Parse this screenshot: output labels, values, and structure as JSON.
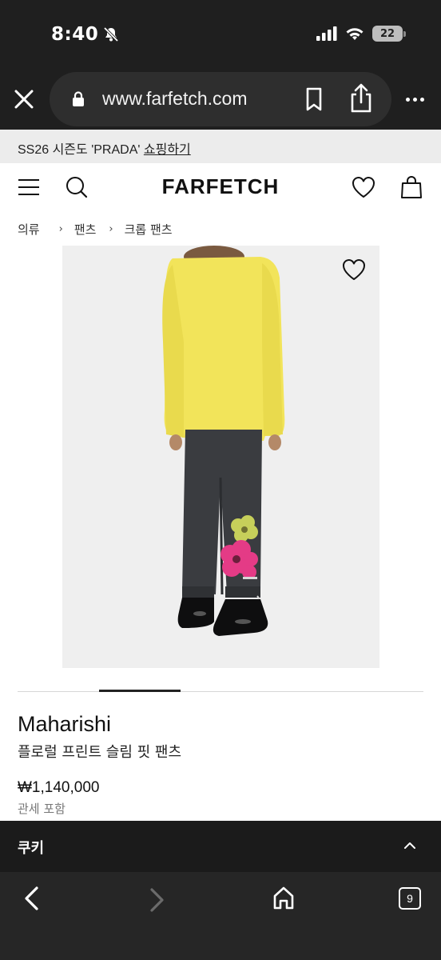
{
  "status_bar": {
    "time": "8:40",
    "battery": "22",
    "icons": [
      "bell-slash-icon",
      "signal-icon",
      "wifi-icon",
      "battery-icon"
    ]
  },
  "browser": {
    "url": "www.farfetch.com",
    "icons": [
      "close-icon",
      "lock-icon",
      "bookmark-icon",
      "share-icon",
      "more-icon"
    ]
  },
  "promo": {
    "text": "SS26 시즌도 'PRADA' ",
    "link": "쇼핑하기"
  },
  "header": {
    "logo": "FARFETCH",
    "icons": [
      "menu-icon",
      "search-icon",
      "heart-icon",
      "bag-icon"
    ]
  },
  "breadcrumb": [
    "의류",
    "팬츠",
    "크롭 팬츠"
  ],
  "product": {
    "brand": "Maharishi",
    "name": "플로럴 프린트 슬림 핏 팬츠",
    "price": "₩1,140,000",
    "tax_note": "관세 포함",
    "carousel_active_index": 2
  },
  "cookie": {
    "title": "쿠키"
  },
  "bottom_nav": {
    "tab_count": "9",
    "icons": [
      "back-icon",
      "forward-icon",
      "home-icon",
      "tabs-icon"
    ]
  },
  "colors": {
    "chrome_dark": "#1f1f1f",
    "promo_bg": "#ececec",
    "sweater_yellow": "#f2e45a",
    "pants_charcoal": "#3a3c40",
    "flower_pink": "#e43b86",
    "flower_lime": "#c6cf5a"
  }
}
